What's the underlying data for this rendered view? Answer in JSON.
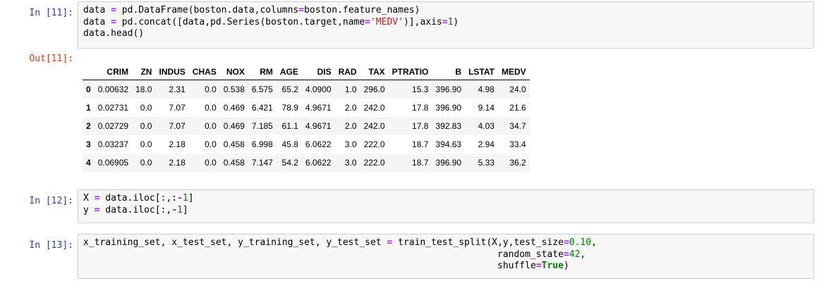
{
  "cells": [
    {
      "prompt": "In [11]:",
      "lines": [
        [
          {
            "t": "data "
          },
          {
            "t": "=",
            "c": "op"
          },
          {
            "t": " pd.DataFrame(boston.data,columns"
          },
          {
            "t": "=",
            "c": "op"
          },
          {
            "t": "boston.feature_names)"
          }
        ],
        [
          {
            "t": "data "
          },
          {
            "t": "=",
            "c": "op"
          },
          {
            "t": " pd.concat([data,pd.Series(boston.target,name"
          },
          {
            "t": "=",
            "c": "op"
          },
          {
            "t": "'MEDV'",
            "c": "str"
          },
          {
            "t": ")],axis"
          },
          {
            "t": "=",
            "c": "op"
          },
          {
            "t": "1",
            "c": "num"
          },
          {
            "t": ")"
          }
        ],
        [
          {
            "t": "data.head()"
          }
        ]
      ]
    },
    {
      "prompt": "In [12]:",
      "lines": [
        [
          {
            "t": "X "
          },
          {
            "t": "=",
            "c": "op"
          },
          {
            "t": " data.iloc[:,:"
          },
          {
            "t": "-",
            "c": "op"
          },
          {
            "t": "1",
            "c": "num"
          },
          {
            "t": "]"
          }
        ],
        [
          {
            "t": "y "
          },
          {
            "t": "=",
            "c": "op"
          },
          {
            "t": " data.iloc[:,"
          },
          {
            "t": "-",
            "c": "op"
          },
          {
            "t": "1",
            "c": "num"
          },
          {
            "t": "]"
          }
        ]
      ]
    },
    {
      "prompt": "In [13]:",
      "lines": [
        [
          {
            "t": "x_training_set, x_test_set, y_training_set, y_test_set "
          },
          {
            "t": "=",
            "c": "op"
          },
          {
            "t": " train_test_split(X,y,test_size"
          },
          {
            "t": "=",
            "c": "op"
          },
          {
            "t": "0.10",
            "c": "num"
          },
          {
            "t": ","
          }
        ],
        [
          {
            "t": "                                                                           random_state"
          },
          {
            "t": "=",
            "c": "op"
          },
          {
            "t": "42",
            "c": "num"
          },
          {
            "t": ","
          }
        ],
        [
          {
            "t": "                                                                           shuffle"
          },
          {
            "t": "=",
            "c": "op"
          },
          {
            "t": "True",
            "c": "kw"
          },
          {
            "t": ")"
          }
        ]
      ]
    }
  ],
  "output": {
    "prompt": "Out[11]:",
    "columns": [
      "",
      "CRIM",
      "ZN",
      "INDUS",
      "CHAS",
      "NOX",
      "RM",
      "AGE",
      "DIS",
      "RAD",
      "TAX",
      "PTRATIO",
      "B",
      "LSTAT",
      "MEDV"
    ],
    "rows": [
      [
        "0",
        "0.00632",
        "18.0",
        "2.31",
        "0.0",
        "0.538",
        "6.575",
        "65.2",
        "4.0900",
        "1.0",
        "296.0",
        "15.3",
        "396.90",
        "4.98",
        "24.0"
      ],
      [
        "1",
        "0.02731",
        "0.0",
        "7.07",
        "0.0",
        "0.469",
        "6.421",
        "78.9",
        "4.9671",
        "2.0",
        "242.0",
        "17.8",
        "396.90",
        "9.14",
        "21.6"
      ],
      [
        "2",
        "0.02729",
        "0.0",
        "7.07",
        "0.0",
        "0.469",
        "7.185",
        "61.1",
        "4.9671",
        "2.0",
        "242.0",
        "17.8",
        "392.83",
        "4.03",
        "34.7"
      ],
      [
        "3",
        "0.03237",
        "0.0",
        "2.18",
        "0.0",
        "0.458",
        "6.998",
        "45.8",
        "6.0622",
        "3.0",
        "222.0",
        "18.7",
        "394.63",
        "2.94",
        "33.4"
      ],
      [
        "4",
        "0.06905",
        "0.0",
        "2.18",
        "0.0",
        "0.458",
        "7.147",
        "54.2",
        "6.0622",
        "3.0",
        "222.0",
        "18.7",
        "396.90",
        "5.33",
        "36.2"
      ]
    ]
  },
  "colors": {
    "in_prompt": "#303f9f",
    "out_prompt": "#d84315",
    "operator": "#aa22ff",
    "string": "#ba2121",
    "number": "#008000",
    "keyword": "#008000",
    "cell_bg": "#f7f7f7",
    "cell_border": "#cfcfcf"
  }
}
